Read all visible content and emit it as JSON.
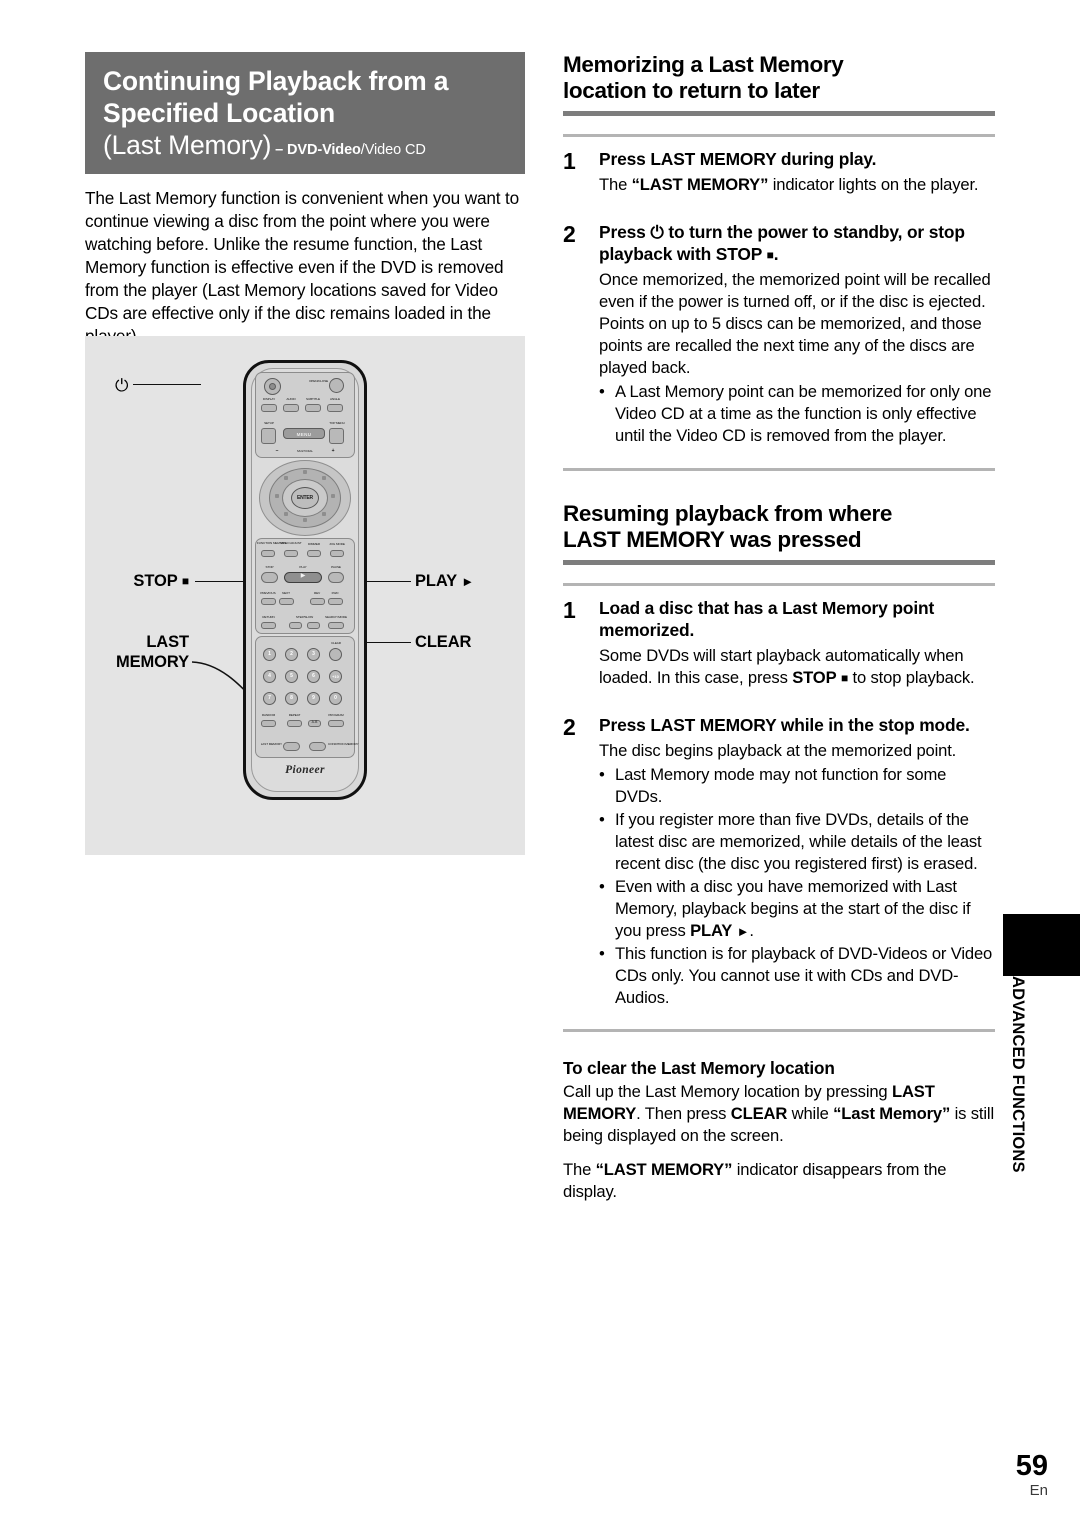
{
  "title_block": {
    "line1": "Continuing Playback from a",
    "line2": "Specified Location",
    "line3_main": "(Last Memory)",
    "line3_dash": " – ",
    "line3_disc_bold": "DVD-Video",
    "line3_disc_thin": "/Video CD"
  },
  "intro": "The Last Memory function is convenient when you want to continue viewing a disc from the point where you were watching before. Unlike the resume function, the Last Memory function is effective even if the DVD is removed from the player (Last Memory locations saved for Video CDs are effective only if the disc remains loaded in the player).",
  "figure": {
    "callouts": {
      "power": "⏻",
      "stop": "STOP",
      "stop_glyph": "■",
      "play": "PLAY",
      "play_glyph": "►",
      "last_memory_line1": "LAST",
      "last_memory_line2": "MEMORY",
      "clear": "CLEAR"
    },
    "remote_keys": {
      "open_close": "OPEN/CLOSE",
      "display": "DISPLAY",
      "audio": "AUDIO",
      "subtitle": "SUBTITLE",
      "angle": "ANGLE",
      "setup": "SETUP",
      "menu": "MENU",
      "top_menu": "TOP MENU",
      "multi_dial": "MULTI DIAL",
      "multi_minus": "–",
      "multi_plus": "+",
      "enter": "ENTER",
      "function_memory": "FUNCTION MEMORY",
      "video_adjust": "VIDEO ADJUST",
      "dimmer": "DIMMER",
      "jog_mode": "JOG MODE",
      "stop": "STOP",
      "play": "PLAY",
      "pause": "PAUSE",
      "previous": "PREVIOUS",
      "next": "NEXT",
      "rev": "REV",
      "fwd": "FWD",
      "return": "RETURN",
      "step_slow": "STEP/SLOW",
      "search_mode": "SEARCH MODE",
      "clear": "CLEAR",
      "num1": "1",
      "num2": "2",
      "num3": "3",
      "num4": "4",
      "num5": "5",
      "num6": "6",
      "num7": "7",
      "num8": "8",
      "num9": "9",
      "num0": "0",
      "num10": "+10",
      "random": "RANDOM",
      "repeat": "REPEAT",
      "ab": "A-B",
      "program": "PROGRAM",
      "last_memory": "LAST MEMORY",
      "condition_memory": "CONDITION MEMORY",
      "brand": "Pioneer"
    }
  },
  "section_memorizing": {
    "heading_line1": "Memorizing a Last Memory",
    "heading_line2": "location to return to later",
    "steps": [
      {
        "num": "1",
        "title": "Press LAST MEMORY during play.",
        "text_pre": "The ",
        "text_bold": "“LAST MEMORY”",
        "text_post": " indicator lights on the player."
      },
      {
        "num": "2",
        "title_pre": "Press ",
        "title_glyph_power": "⏻",
        "title_mid": " to turn the power to standby, or stop playback with STOP ",
        "title_glyph_stop": "■",
        "title_post": ".",
        "text": "Once memorized, the memorized point will be recalled even if the power is turned off, or if the disc is ejected. Points on up to 5 discs can be memorized, and those points are recalled the next time any of the discs are played back.",
        "bullets": [
          "A Last Memory point can be memorized for only one Video CD at a time as the function is only effective until the Video CD is removed from the player."
        ]
      }
    ]
  },
  "section_resuming": {
    "heading_line1": "Resuming playback from where",
    "heading_line2": "LAST MEMORY was pressed",
    "steps": [
      {
        "num": "1",
        "title": "Load a disc that has a Last Memory point memorized.",
        "text_pre": "Some DVDs will start playback automatically when loaded. In this case, press ",
        "text_bold": "STOP",
        "text_glyph": "■",
        "text_post": " to stop playback."
      },
      {
        "num": "2",
        "title": "Press LAST MEMORY while in the stop mode.",
        "text": "The disc begins playback at the memorized point.",
        "bullets": [
          {
            "text": "Last Memory mode may not function for some DVDs."
          },
          {
            "text": "If you register more than five DVDs, details of the latest disc are memorized, while details of the least recent disc (the disc you registered first) is erased."
          },
          {
            "pre": "Even with a disc you have memorized with Last Memory, playback begins at the start of the disc if you press ",
            "bold": "PLAY",
            "glyph": "►",
            "post": "."
          },
          {
            "text": "This function is for playback of DVD-Videos or Video CDs only. You cannot use it with CDs and DVD-Audios."
          }
        ]
      }
    ]
  },
  "section_clear": {
    "heading": "To clear the Last Memory location",
    "para1_pre": "Call up the Last Memory location by pressing ",
    "para1_bold1": "LAST MEMORY",
    "para1_mid": ". Then press ",
    "para1_bold2": "CLEAR",
    "para1_mid2": " while ",
    "para1_bold3": "“Last Memory”",
    "para1_post": " is still being displayed on the screen.",
    "para2_pre": "The ",
    "para2_bold": "“LAST MEMORY”",
    "para2_post": " indicator disappears from the display."
  },
  "side_tab": {
    "label": "ADVANCED FUNCTIONS"
  },
  "footer": {
    "page_number": "59",
    "language": "En"
  }
}
